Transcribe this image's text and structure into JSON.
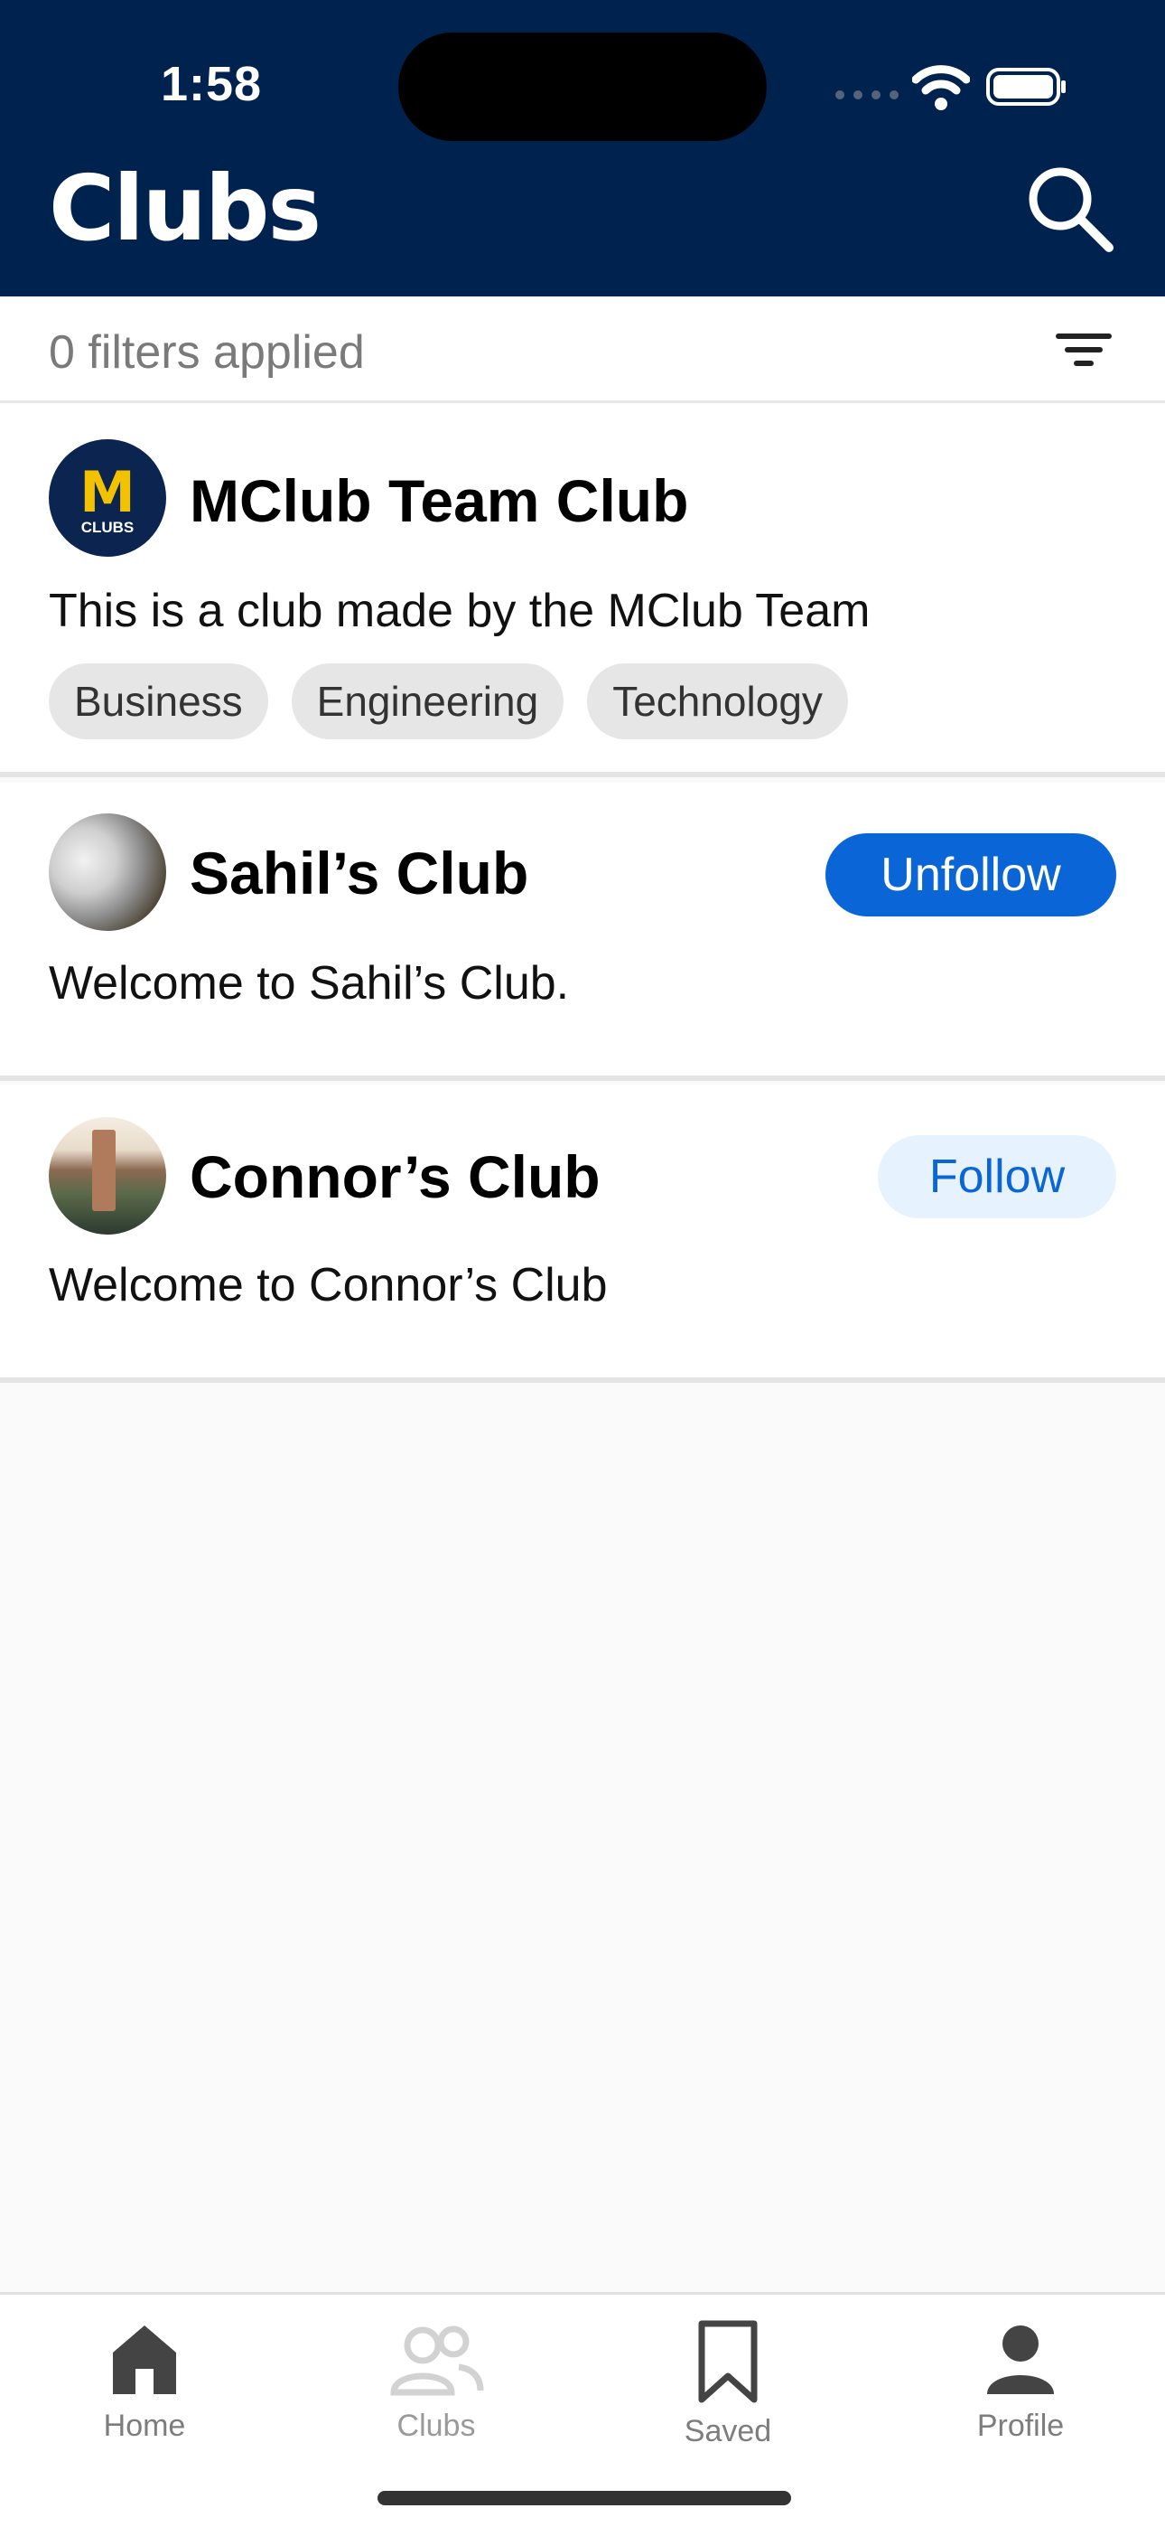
{
  "status_bar": {
    "time": "1:58"
  },
  "header": {
    "title": "Clubs",
    "search_icon": "search-icon"
  },
  "filter_bar": {
    "text": "0 filters applied",
    "icon": "filter-icon"
  },
  "clubs": [
    {
      "logo_letter": "M",
      "logo_text": "CLUBS",
      "name": "MClub Team Club",
      "description": "This is a club made by the MClub Team",
      "tags": [
        "Business",
        "Engineering",
        "Technology"
      ]
    },
    {
      "name": "Sahil’s Club",
      "description": "Welcome to Sahil’s Club.",
      "button_label": "Unfollow"
    },
    {
      "name": "Connor’s Club",
      "description": "Welcome to Connor’s Club",
      "button_label": "Follow"
    }
  ],
  "nav": {
    "items": [
      {
        "label": "Home",
        "icon": "home-icon"
      },
      {
        "label": "Clubs",
        "icon": "clubs-icon"
      },
      {
        "label": "Saved",
        "icon": "bookmark-icon"
      },
      {
        "label": "Profile",
        "icon": "profile-icon"
      }
    ]
  },
  "colors": {
    "header_bg": "#00224e",
    "accent": "#0a66d6",
    "follow_bg": "#e6f2fd",
    "logo_yellow": "#f2c200"
  }
}
